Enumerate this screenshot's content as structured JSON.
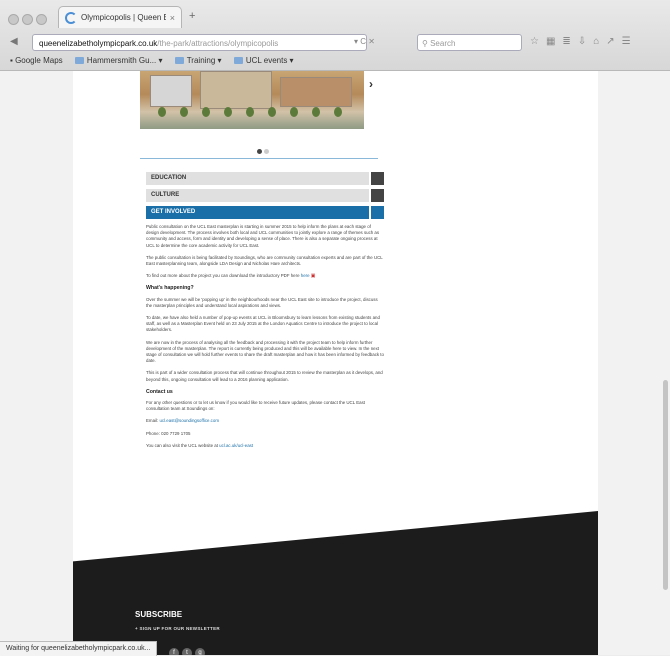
{
  "browser": {
    "tab_title": "Olympicopolis | Queen El...",
    "tab_close": "×",
    "new_tab": "+",
    "url_host": "queenelizabetholympicpark.co.uk",
    "url_path": "/the-park/attractions/olympicopolis",
    "search_placeholder": "Search",
    "bookmarks": [
      {
        "label": "Google Maps",
        "type": "page"
      },
      {
        "label": "Hammersmith Gu...",
        "type": "folder"
      },
      {
        "label": "Training",
        "type": "folder"
      },
      {
        "label": "UCL events",
        "type": "folder"
      }
    ]
  },
  "page": {
    "accordion": [
      {
        "label": "EDUCATION",
        "active": false
      },
      {
        "label": "CULTURE",
        "active": false
      },
      {
        "label": "GET INVOLVED",
        "active": true
      }
    ],
    "intro_p1": "Public consultation on the UCL East masterplan is starting in summer 2015 to help inform the plans at each stage of design development. The process involves both local and UCL communities to jointly explore a range of themes such as community and access, form and identity and developing a sense of place. There is also a separate ongoing process at UCL to determine the core academic activity for UCL East.",
    "intro_p2": "The public consultation is being facilitated by Soundings, who are community consultation experts and are part of the UCL East masterplanning team, alongside LDA Design and Nicholas Hare architects.",
    "intro_p3": "To find out more about the project you can download the introductory PDF here",
    "intro_p3_link": "here",
    "happening_heading": "What's happening?",
    "happening_p1": "Over the summer we will be 'popping up' in the neighbourhoods near the UCL East site to introduce the project, discuss the masterplan principles and understand local aspirations and views.",
    "happening_p2": "To date, we have also held a number of pop-up events at UCL in Bloomsbury to learn lessons from existing students and staff, as well as a Masterplan Event held on 23 July 2015 at the London Aquatics Centre to introduce the project to local stakeholders.",
    "happening_p3": "We are now in the process of analysing all the feedback and processing it with the project team to help inform further development of the masterplan. The report is currently being produced and this will be available here to view. In the next stage of consultation we will hold further events to share the draft masterplan and how it has been informed by feedback to date.",
    "happening_p4": "This is part of a wider consultation process that will continue throughout 2015 to review the masterplan as it develops, and beyond this, ongoing consultation will lead to a 2016 planning application.",
    "contact_heading": "Contact us",
    "contact_p1": "For any other questions or to let us know if you would like to receive future updates, please contact the UCL East consultation team at Soundings on:",
    "email_label": "Email:",
    "email_value": "ucl.east@soundingsoffice.com",
    "phone_label": "Phone:",
    "phone_value": "020 7729 1705",
    "visit_text": "You can also visit the UCL website at",
    "visit_link": "ucl.ac.uk/ucl-east",
    "subscribe_title": "SUBSCRIBE",
    "subscribe_link": "+ SIGN UP FOR OUR NEWSLETTER",
    "social": [
      "f",
      "t",
      "g"
    ]
  },
  "status_text": "Waiting for queenelizabetholympicpark.co.uk..."
}
